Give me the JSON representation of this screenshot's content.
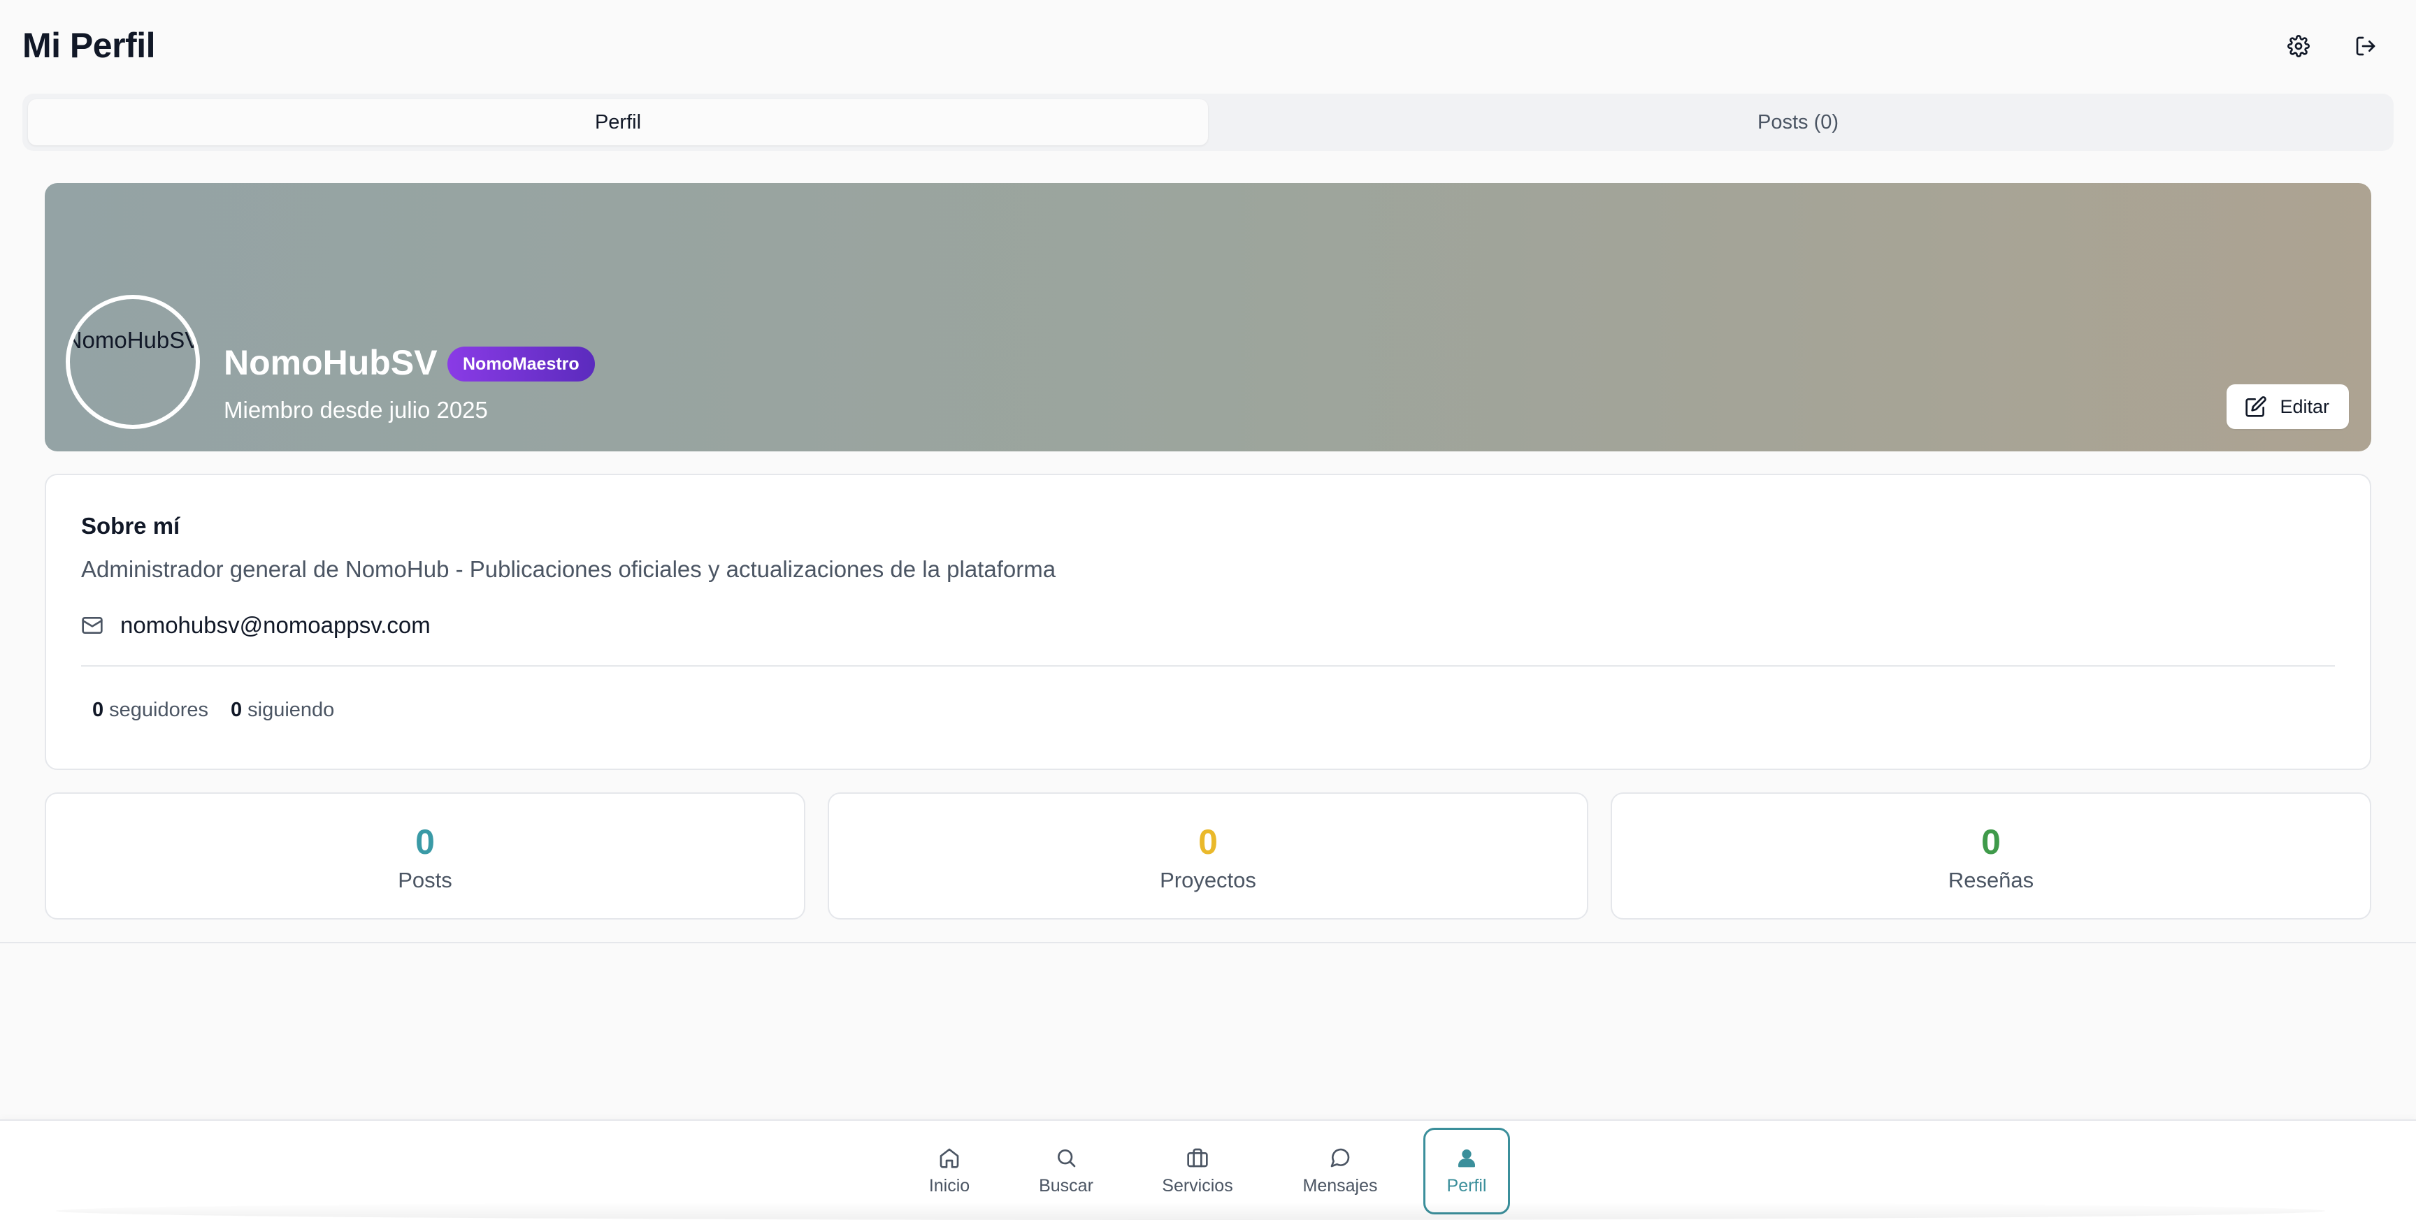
{
  "header": {
    "title": "Mi Perfil",
    "settings_icon": "gear-icon",
    "logout_icon": "logout-icon"
  },
  "tabs": [
    {
      "label": "Perfil",
      "active": true
    },
    {
      "label": "Posts (0)",
      "active": false
    }
  ],
  "profile": {
    "avatar_text": "NomoHubSV",
    "name": "NomoHubSV",
    "badge": "NomoMaestro",
    "member_since": "Miembro desde julio 2025",
    "edit_label": "Editar"
  },
  "about": {
    "title": "Sobre mí",
    "description": "Administrador general de NomoHub - Publicaciones oficiales y actualizaciones de la plataforma",
    "email": "nomohubsv@nomoappsv.com",
    "followers_count": "0",
    "followers_label": "seguidores",
    "following_count": "0",
    "following_label": "siguiendo"
  },
  "stats": [
    {
      "value": "0",
      "label": "Posts",
      "color": "#3a9aa6"
    },
    {
      "value": "0",
      "label": "Proyectos",
      "color": "#eab92b"
    },
    {
      "value": "0",
      "label": "Reseñas",
      "color": "#3f9a4a"
    }
  ],
  "nav": [
    {
      "label": "Inicio",
      "icon": "home-icon",
      "active": false
    },
    {
      "label": "Buscar",
      "icon": "search-icon",
      "active": false
    },
    {
      "label": "Servicios",
      "icon": "briefcase-icon",
      "active": false
    },
    {
      "label": "Mensajes",
      "icon": "message-icon",
      "active": false
    },
    {
      "label": "Perfil",
      "icon": "user-icon",
      "active": true
    }
  ],
  "colors": {
    "accent": "#3b8f9b",
    "badge": "#7a35d8"
  }
}
